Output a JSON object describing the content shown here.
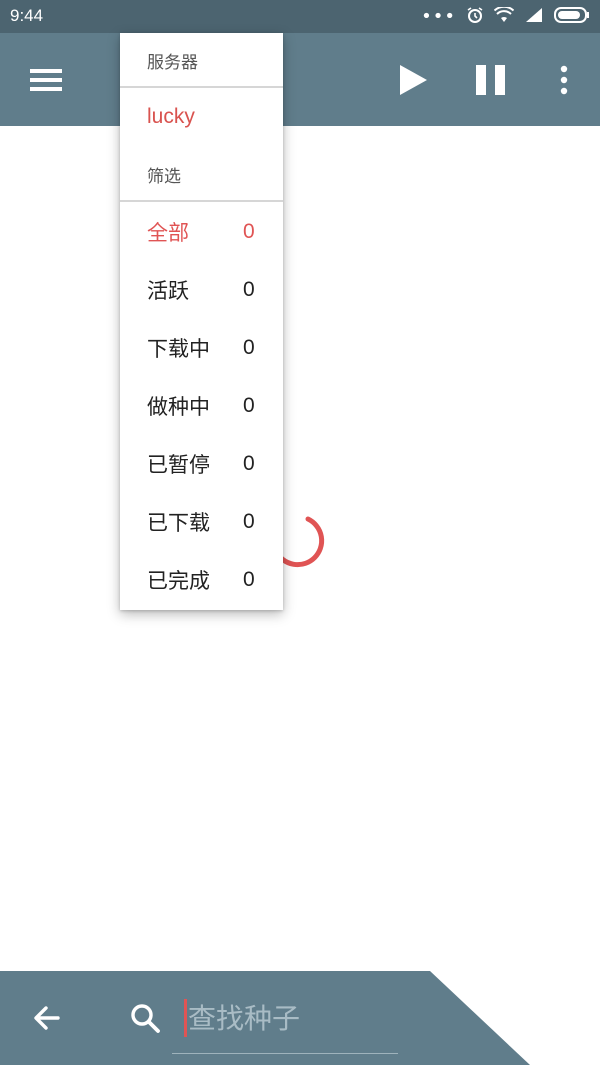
{
  "status_bar": {
    "time": "9:44",
    "icons": [
      "more-dots-icon",
      "alarm-icon",
      "wifi-icon",
      "signal-icon",
      "battery-icon"
    ]
  },
  "toolbar": {
    "icons": [
      "menu-icon",
      "play-icon",
      "pause-icon",
      "more-vert-icon"
    ]
  },
  "dropdown": {
    "server_header": "服务器",
    "server_name": "lucky",
    "filter_header": "筛选",
    "filters": [
      {
        "label": "全部",
        "count": "0",
        "selected": true
      },
      {
        "label": "活跃",
        "count": "0",
        "selected": false
      },
      {
        "label": "下载中",
        "count": "0",
        "selected": false
      },
      {
        "label": "做种中",
        "count": "0",
        "selected": false
      },
      {
        "label": "已暂停",
        "count": "0",
        "selected": false
      },
      {
        "label": "已下载",
        "count": "0",
        "selected": false
      },
      {
        "label": "已完成",
        "count": "0",
        "selected": false
      }
    ]
  },
  "search": {
    "placeholder": "查找种子",
    "value": ""
  },
  "colors": {
    "status_bar": "#4c6470",
    "toolbar": "#607d8b",
    "accent": "#e05454"
  }
}
